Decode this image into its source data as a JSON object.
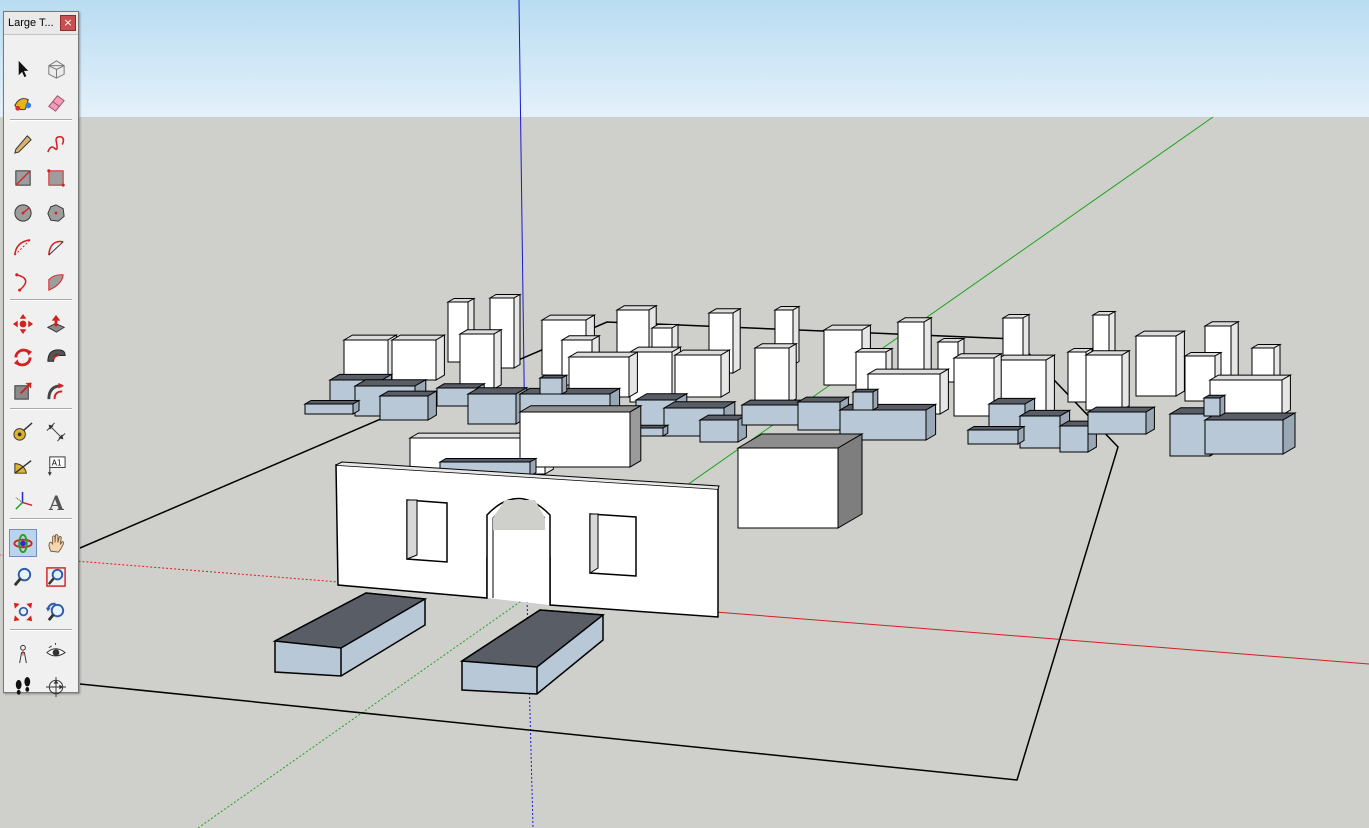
{
  "window": {
    "title": "Large T...",
    "close_glyph": "×"
  },
  "toolbar": {
    "tools": [
      {
        "id": "select",
        "icon": "select-icon"
      },
      {
        "id": "make-component",
        "icon": "make-component-icon"
      },
      {
        "id": "paint-bucket",
        "icon": "paint-bucket-icon"
      },
      {
        "id": "eraser",
        "icon": "eraser-icon"
      },
      {
        "id": "line",
        "icon": "pencil-line-icon"
      },
      {
        "id": "freehand",
        "icon": "freehand-icon"
      },
      {
        "id": "rectangle",
        "icon": "rectangle-icon"
      },
      {
        "id": "rotated-rectangle",
        "icon": "rotated-rectangle-icon"
      },
      {
        "id": "circle",
        "icon": "circle-icon"
      },
      {
        "id": "polygon",
        "icon": "polygon-icon"
      },
      {
        "id": "arc",
        "icon": "arc-icon"
      },
      {
        "id": "two-point-arc",
        "icon": "two-point-arc-icon"
      },
      {
        "id": "three-point-arc",
        "icon": "three-point-arc-icon"
      },
      {
        "id": "pie",
        "icon": "pie-icon"
      },
      {
        "id": "move",
        "icon": "move-icon"
      },
      {
        "id": "push-pull",
        "icon": "push-pull-icon"
      },
      {
        "id": "rotate",
        "icon": "rotate-icon"
      },
      {
        "id": "follow-me",
        "icon": "follow-me-icon"
      },
      {
        "id": "scale",
        "icon": "scale-icon"
      },
      {
        "id": "offset",
        "icon": "offset-icon"
      },
      {
        "id": "tape-measure",
        "icon": "tape-measure-icon"
      },
      {
        "id": "dimension",
        "icon": "dimension-icon"
      },
      {
        "id": "protractor",
        "icon": "protractor-icon"
      },
      {
        "id": "text",
        "icon": "text-icon",
        "label": "A1"
      },
      {
        "id": "axes",
        "icon": "axes-icon"
      },
      {
        "id": "3d-text",
        "icon": "3d-text-icon",
        "label": "A"
      },
      {
        "id": "orbit",
        "icon": "orbit-icon",
        "active": true
      },
      {
        "id": "pan",
        "icon": "pan-hand-icon"
      },
      {
        "id": "zoom",
        "icon": "zoom-icon"
      },
      {
        "id": "zoom-window",
        "icon": "zoom-window-icon"
      },
      {
        "id": "zoom-extents",
        "icon": "zoom-extents-icon"
      },
      {
        "id": "previous-view",
        "icon": "previous-view-icon"
      },
      {
        "id": "position-camera",
        "icon": "position-camera-icon"
      },
      {
        "id": "look-around",
        "icon": "look-around-icon"
      },
      {
        "id": "walk",
        "icon": "walk-icon"
      },
      {
        "id": "section-plane",
        "icon": "section-plane-icon"
      }
    ]
  },
  "colors": {
    "sky_top": "#b9dcf2",
    "sky_bottom": "#e4f1fa",
    "ground": "#cfcfcb",
    "red_axis": "#d42020",
    "green_axis": "#1fa51f",
    "blue_axis": "#1a1ad0",
    "face_light": "#ffffff",
    "face_mid": "#b9c8d6",
    "face_dark": "#595e66",
    "edge": "#000000",
    "toolbar_bg": "#f0f0f0",
    "toolbar_active": "#bcd3ee"
  }
}
